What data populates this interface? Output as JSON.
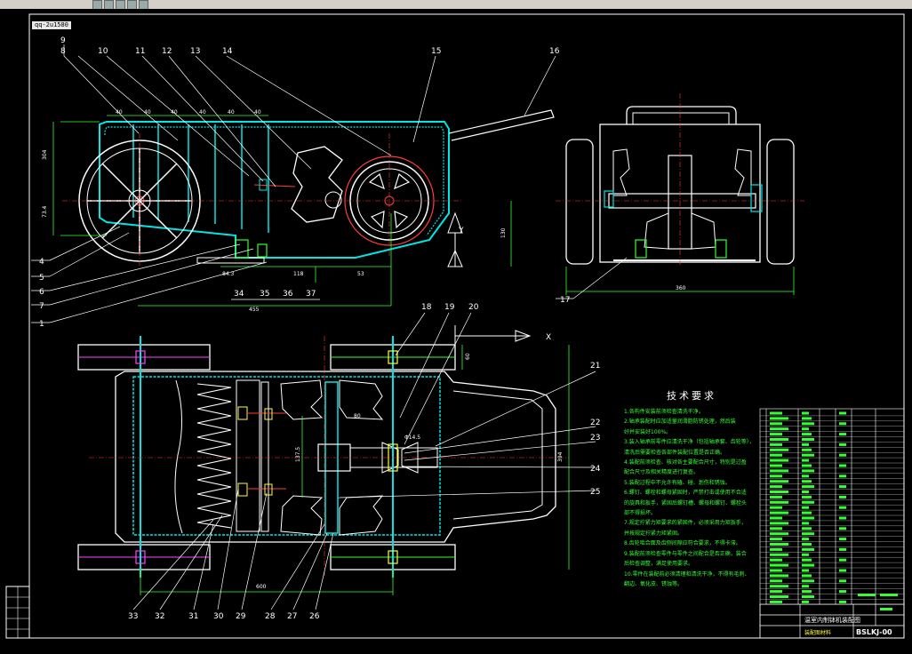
{
  "toolbar": {
    "command_tag": "qq-2u1580"
  },
  "drawing": {
    "part_labels_top": [
      "9",
      "8",
      "10",
      "11",
      "12",
      "13",
      "14",
      "15",
      "16"
    ],
    "part_labels_left": [
      "4",
      "5",
      "6",
      "7",
      "1"
    ],
    "part_labels_row": [
      "34",
      "35",
      "36",
      "37"
    ],
    "part_labels_mid": [
      "18",
      "19",
      "20"
    ],
    "part_labels_right_top": [
      "17"
    ],
    "part_labels_right": [
      "21",
      "22",
      "23",
      "24",
      "25"
    ],
    "part_labels_bottom": [
      "33",
      "32",
      "31",
      "30",
      "29",
      "28",
      "27",
      "26"
    ],
    "section_mark": "X",
    "section_mark_y": "Y"
  },
  "tech_requirements": {
    "title": "技术要求",
    "items": [
      "1.各构件安装前须检查清洗干净。",
      "2.轴承装配时应加适量润滑脂防锈处理，然后装",
      "好并安装好100%。",
      "3.装入轴承前零件应清洗干净（包括轴承套、齿轮等），",
      "清洗后需要检查各部件装配位置是否正确。",
      "4.装配前须检查、核对各主要配合尺寸，特别是过盈",
      "配合尺寸及相关精度进行复查。",
      "5.装配过程中不允许有磕、碰、划伤和锈蚀。",
      "6.螺钉、螺栓和螺母紧固时，严禁打击或使用不合适",
      "的旋具和扳手，紧固后螺钉槽、螺母和螺钉、螺栓头",
      "部不得损坏。",
      "7.规定拧紧力矩要求的紧固件，必须采用力矩扳手，",
      "并按规定拧紧力矩紧固。",
      "8.齿轮啮合面及齿侧间隙应符合要求，不得卡滞。",
      "9.装配前须检查零件与零件之间配合是否正确，装合",
      "后检查调整，满足使用要求。",
      "10.零件在装配前必须清理和清洗干净，不得有毛刺、",
      "翻边、氧化皮、锈蚀等。"
    ]
  },
  "title_block": {
    "name": "温室内制钵机装配图",
    "drawing_number": "BSLKJ-00",
    "material_label": "装配图材料"
  },
  "colors": {
    "frame": "#ffffff",
    "cyan": "#00e5e5",
    "red": "#ff3b3b",
    "green": "#33ff33",
    "yellow": "#ffff33",
    "magenta": "#ff44ff",
    "background": "#000000"
  }
}
